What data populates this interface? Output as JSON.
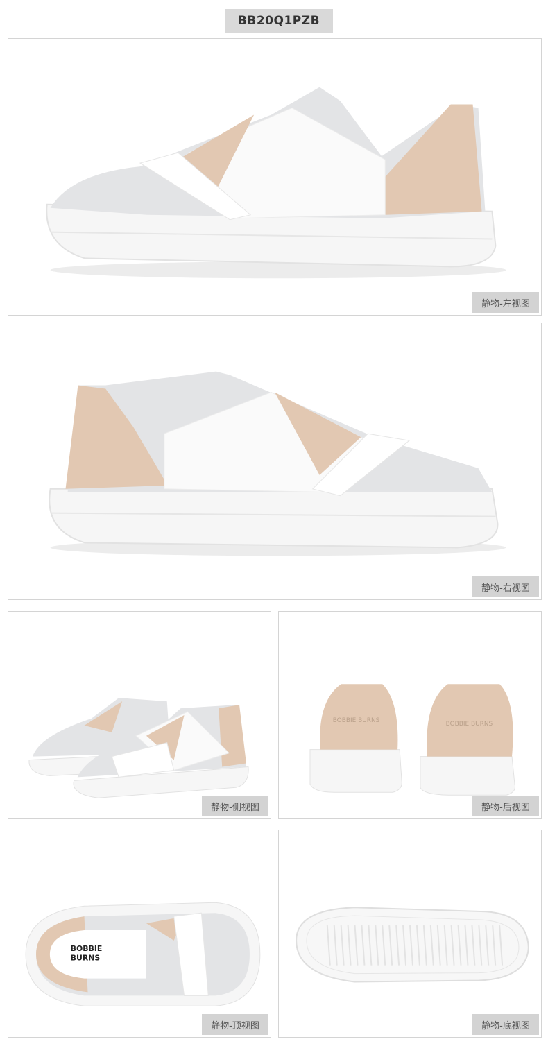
{
  "sku": "BB20Q1PZB",
  "colors": {
    "upper_gray": "#e3e4e6",
    "upper_white": "#fafafa",
    "accent_beige": "#e2c8b2",
    "sole_white": "#f7f7f7",
    "tag_bg": "#d3d3d3"
  },
  "views": [
    {
      "label": "静物-左视图",
      "image": "shoe-left-view"
    },
    {
      "label": "静物-右视图",
      "image": "shoe-right-view"
    },
    {
      "label": "静物-侧视图",
      "image": "shoe-pair-side-view"
    },
    {
      "label": "静物-后视图",
      "image": "shoe-pair-back-view"
    },
    {
      "label": "静物-顶视图",
      "image": "shoe-top-view"
    },
    {
      "label": "静物-底视图",
      "image": "shoe-sole-bottom-view"
    }
  ],
  "brand_logo_text": "BOBBIE BURNS"
}
